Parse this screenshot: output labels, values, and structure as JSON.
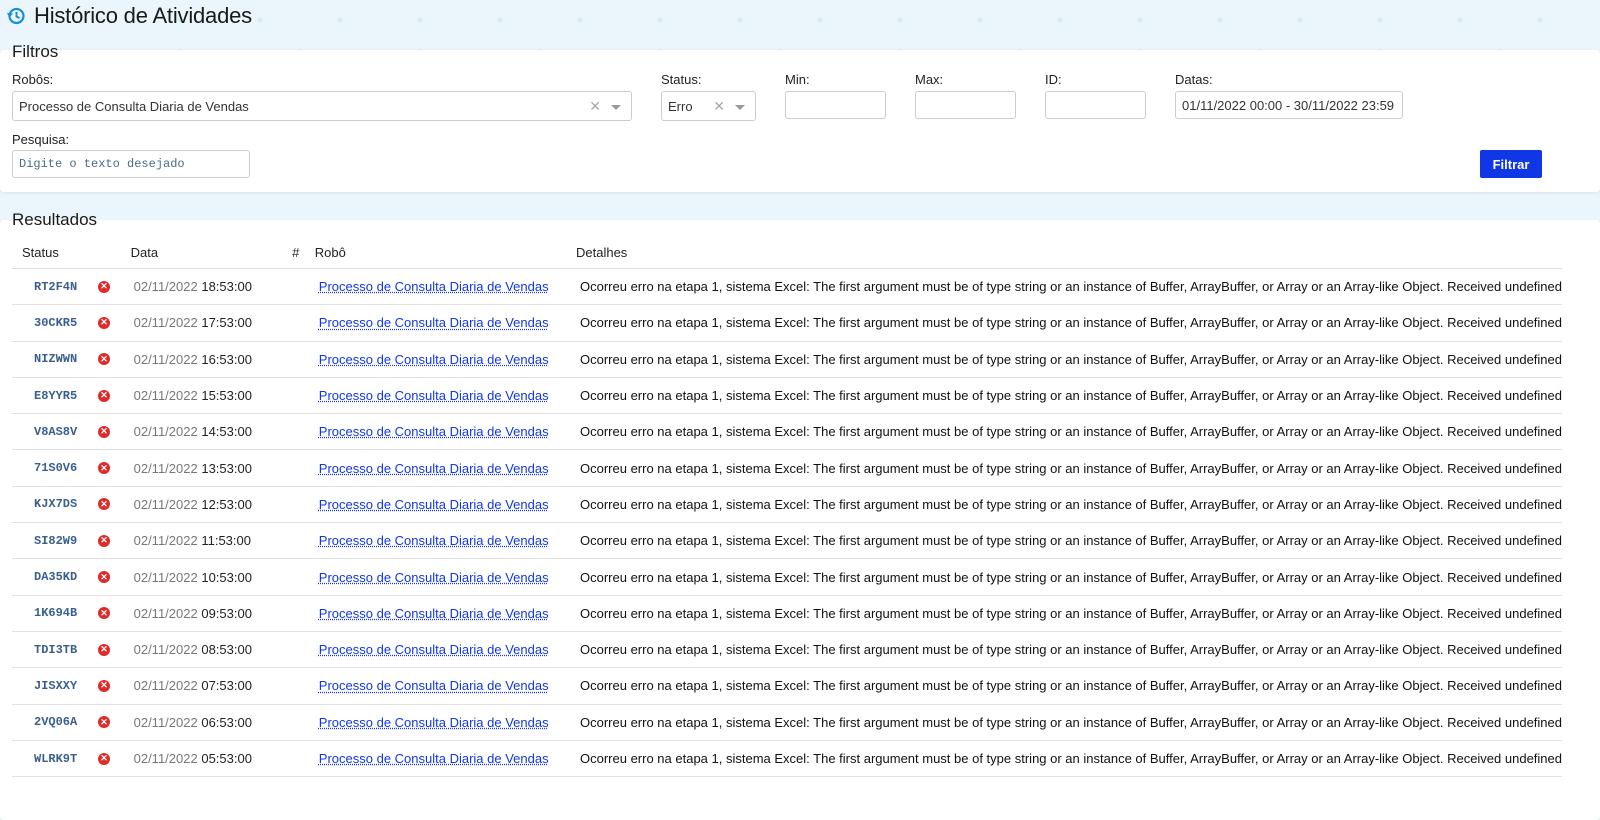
{
  "header": {
    "title": "Histórico de Atividades",
    "icon": "history-icon"
  },
  "filters": {
    "title": "Filtros",
    "robots_label": "Robôs:",
    "robots_value": "Processo de Consulta Diaria de Vendas",
    "status_label": "Status:",
    "status_value": "Erro",
    "min_label": "Min:",
    "max_label": "Max:",
    "id_label": "ID:",
    "dates_label": "Datas:",
    "dates_value": "01/11/2022 00:00 - 30/11/2022 23:59",
    "search_label": "Pesquisa:",
    "search_placeholder": "Digite o texto desejado",
    "filter_button": "Filtrar",
    "accent_color": "#1036e6"
  },
  "results": {
    "title": "Resultados",
    "columns": [
      "Status",
      "Data",
      "#",
      "Robô",
      "Detalhes"
    ],
    "rows": [
      {
        "code": "RT2F4N",
        "date": "02/11/2022",
        "time": "18:53:00",
        "robot": "Processo de Consulta Diaria de Vendas",
        "details": "Ocorreu erro na etapa 1, sistema Excel: The first argument must be of type string or an instance of Buffer, ArrayBuffer, or Array or an Array-like Object. Received undefined"
      },
      {
        "code": "30CKR5",
        "date": "02/11/2022",
        "time": "17:53:00",
        "robot": "Processo de Consulta Diaria de Vendas",
        "details": "Ocorreu erro na etapa 1, sistema Excel: The first argument must be of type string or an instance of Buffer, ArrayBuffer, or Array or an Array-like Object. Received undefined"
      },
      {
        "code": "NIZWWN",
        "date": "02/11/2022",
        "time": "16:53:00",
        "robot": "Processo de Consulta Diaria de Vendas",
        "details": "Ocorreu erro na etapa 1, sistema Excel: The first argument must be of type string or an instance of Buffer, ArrayBuffer, or Array or an Array-like Object. Received undefined"
      },
      {
        "code": "E8YYR5",
        "date": "02/11/2022",
        "time": "15:53:00",
        "robot": "Processo de Consulta Diaria de Vendas",
        "details": "Ocorreu erro na etapa 1, sistema Excel: The first argument must be of type string or an instance of Buffer, ArrayBuffer, or Array or an Array-like Object. Received undefined"
      },
      {
        "code": "V8AS8V",
        "date": "02/11/2022",
        "time": "14:53:00",
        "robot": "Processo de Consulta Diaria de Vendas",
        "details": "Ocorreu erro na etapa 1, sistema Excel: The first argument must be of type string or an instance of Buffer, ArrayBuffer, or Array or an Array-like Object. Received undefined"
      },
      {
        "code": "71S0V6",
        "date": "02/11/2022",
        "time": "13:53:00",
        "robot": "Processo de Consulta Diaria de Vendas",
        "details": "Ocorreu erro na etapa 1, sistema Excel: The first argument must be of type string or an instance of Buffer, ArrayBuffer, or Array or an Array-like Object. Received undefined"
      },
      {
        "code": "KJX7DS",
        "date": "02/11/2022",
        "time": "12:53:00",
        "robot": "Processo de Consulta Diaria de Vendas",
        "details": "Ocorreu erro na etapa 1, sistema Excel: The first argument must be of type string or an instance of Buffer, ArrayBuffer, or Array or an Array-like Object. Received undefined"
      },
      {
        "code": "SI82W9",
        "date": "02/11/2022",
        "time": "11:53:00",
        "robot": "Processo de Consulta Diaria de Vendas",
        "details": "Ocorreu erro na etapa 1, sistema Excel: The first argument must be of type string or an instance of Buffer, ArrayBuffer, or Array or an Array-like Object. Received undefined"
      },
      {
        "code": "DA35KD",
        "date": "02/11/2022",
        "time": "10:53:00",
        "robot": "Processo de Consulta Diaria de Vendas",
        "details": "Ocorreu erro na etapa 1, sistema Excel: The first argument must be of type string or an instance of Buffer, ArrayBuffer, or Array or an Array-like Object. Received undefined"
      },
      {
        "code": "1K694B",
        "date": "02/11/2022",
        "time": "09:53:00",
        "robot": "Processo de Consulta Diaria de Vendas",
        "details": "Ocorreu erro na etapa 1, sistema Excel: The first argument must be of type string or an instance of Buffer, ArrayBuffer, or Array or an Array-like Object. Received undefined"
      },
      {
        "code": "TDI3TB",
        "date": "02/11/2022",
        "time": "08:53:00",
        "robot": "Processo de Consulta Diaria de Vendas",
        "details": "Ocorreu erro na etapa 1, sistema Excel: The first argument must be of type string or an instance of Buffer, ArrayBuffer, or Array or an Array-like Object. Received undefined"
      },
      {
        "code": "JISXXY",
        "date": "02/11/2022",
        "time": "07:53:00",
        "robot": "Processo de Consulta Diaria de Vendas",
        "details": "Ocorreu erro na etapa 1, sistema Excel: The first argument must be of type string or an instance of Buffer, ArrayBuffer, or Array or an Array-like Object. Received undefined"
      },
      {
        "code": "2VQ06A",
        "date": "02/11/2022",
        "time": "06:53:00",
        "robot": "Processo de Consulta Diaria de Vendas",
        "details": "Ocorreu erro na etapa 1, sistema Excel: The first argument must be of type string or an instance of Buffer, ArrayBuffer, or Array or an Array-like Object. Received undefined"
      },
      {
        "code": "WLRK9T",
        "date": "02/11/2022",
        "time": "05:53:00",
        "robot": "Processo de Consulta Diaria de Vendas",
        "details": "Ocorreu erro na etapa 1, sistema Excel: The first argument must be of type string or an instance of Buffer, ArrayBuffer, or Array or an Array-like Object. Received undefined"
      }
    ],
    "status_icon": "error-icon",
    "error_color": "#e02a2a",
    "link_color": "#1036e6"
  }
}
